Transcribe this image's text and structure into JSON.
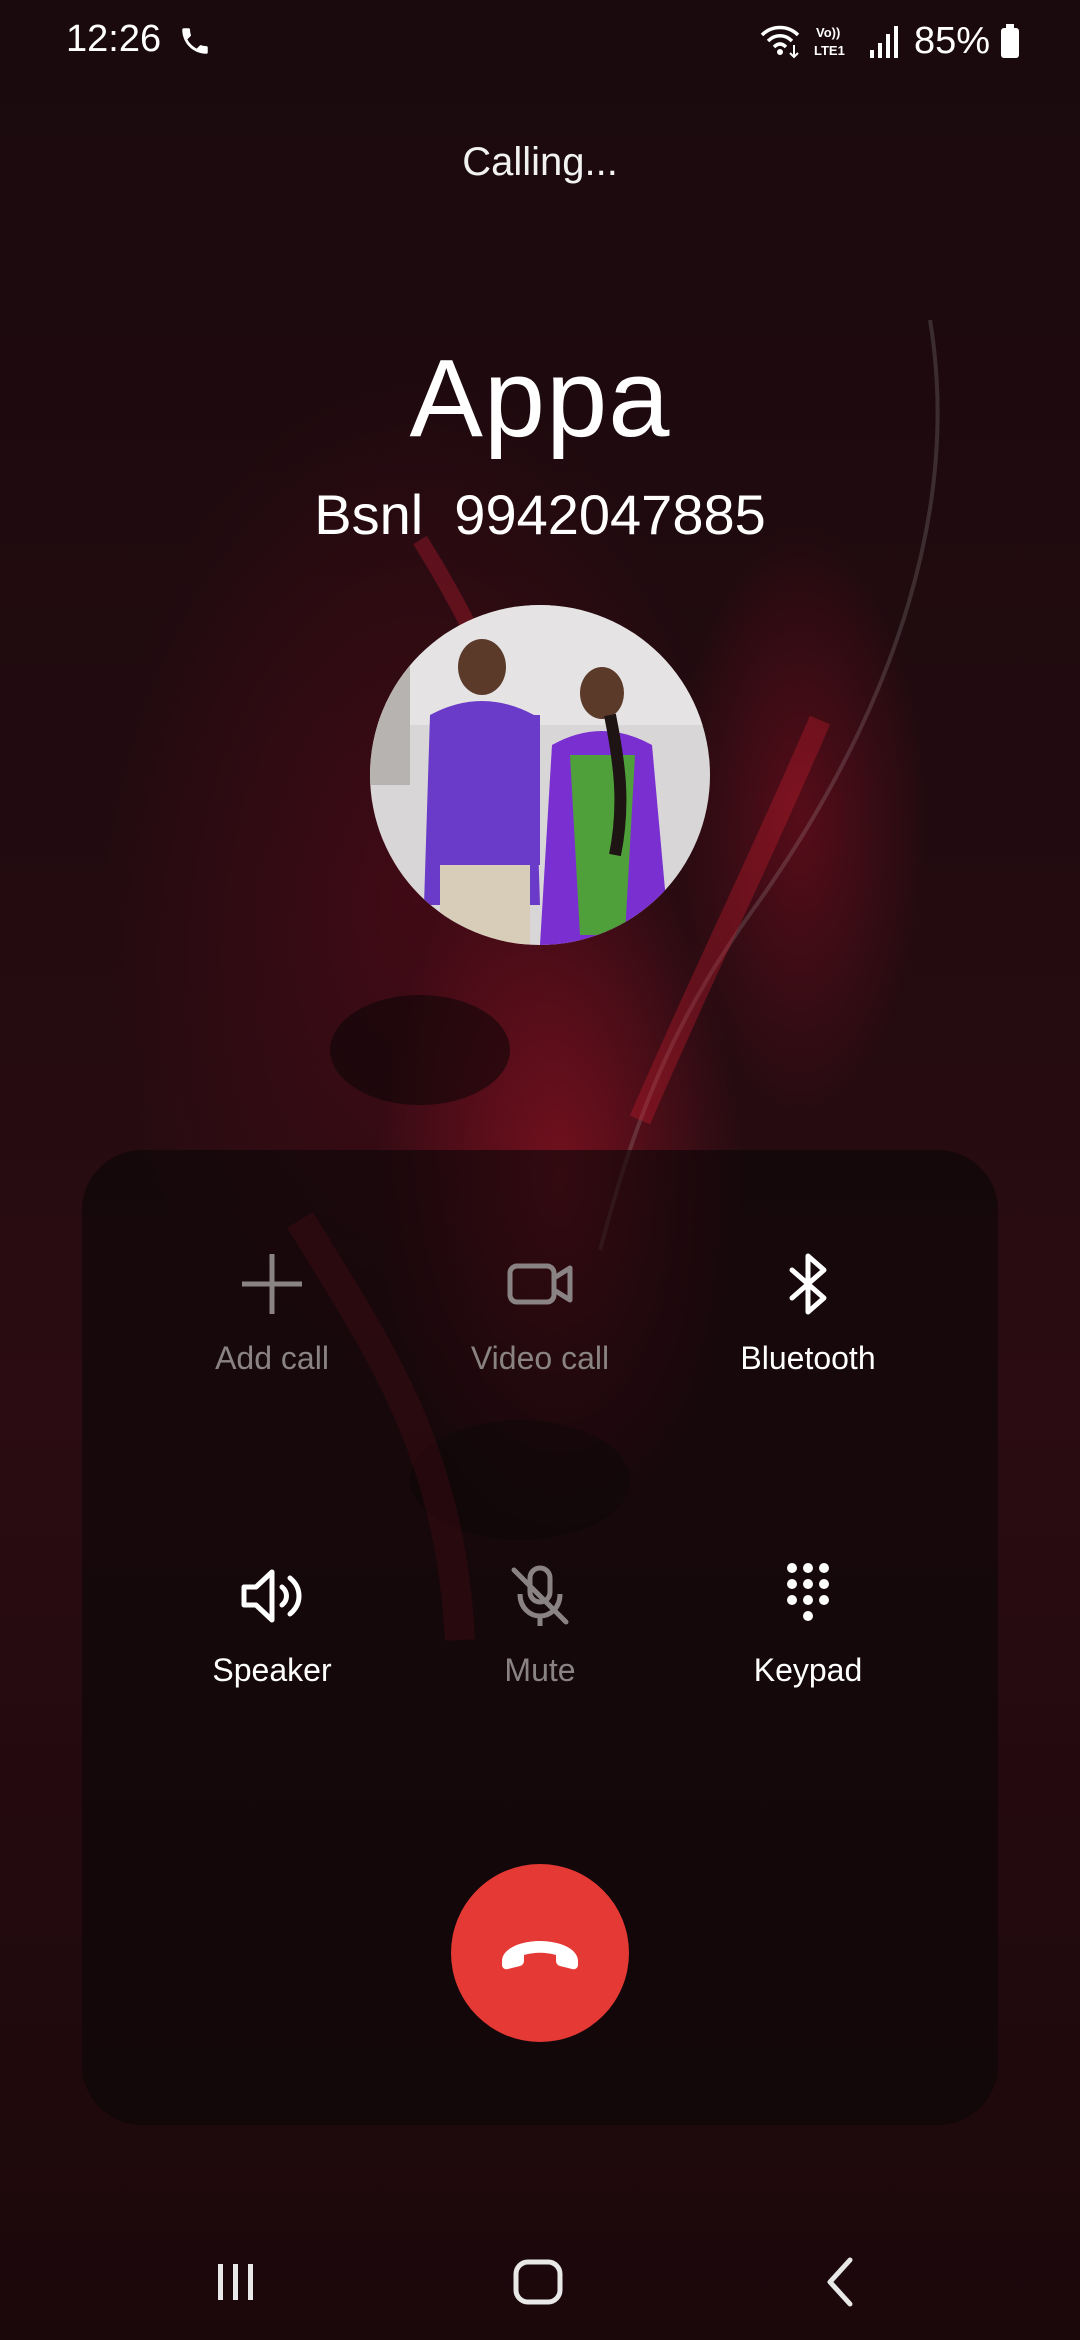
{
  "status_bar": {
    "time": "12:26",
    "battery_percent": "85%",
    "icons": [
      "phone-call-icon",
      "wifi-icon",
      "volte-lte1-icon",
      "signal-icon",
      "battery-icon"
    ]
  },
  "call": {
    "status": "Calling...",
    "contact_name": "Appa",
    "carrier": "Bsnl",
    "number": "9942047885",
    "display_number": "Bsnl  9942047885"
  },
  "controls": [
    {
      "label": "Add call",
      "icon": "plus-icon",
      "enabled": false
    },
    {
      "label": "Video call",
      "icon": "video-camera-icon",
      "enabled": false
    },
    {
      "label": "Bluetooth",
      "icon": "bluetooth-icon",
      "enabled": true
    },
    {
      "label": "Speaker",
      "icon": "speaker-icon",
      "enabled": true
    },
    {
      "label": "Mute",
      "icon": "mic-off-icon",
      "enabled": false
    },
    {
      "label": "Keypad",
      "icon": "keypad-icon",
      "enabled": true
    }
  ],
  "end_call": {
    "icon": "end-call-icon",
    "color": "#e53935"
  },
  "navigation": {
    "icons": [
      "recent-apps-icon",
      "home-icon",
      "back-icon"
    ]
  },
  "colors": {
    "accent_end_call": "#e53935",
    "disabled_text": "#8a8384",
    "panel_bg": "#0c0608"
  }
}
